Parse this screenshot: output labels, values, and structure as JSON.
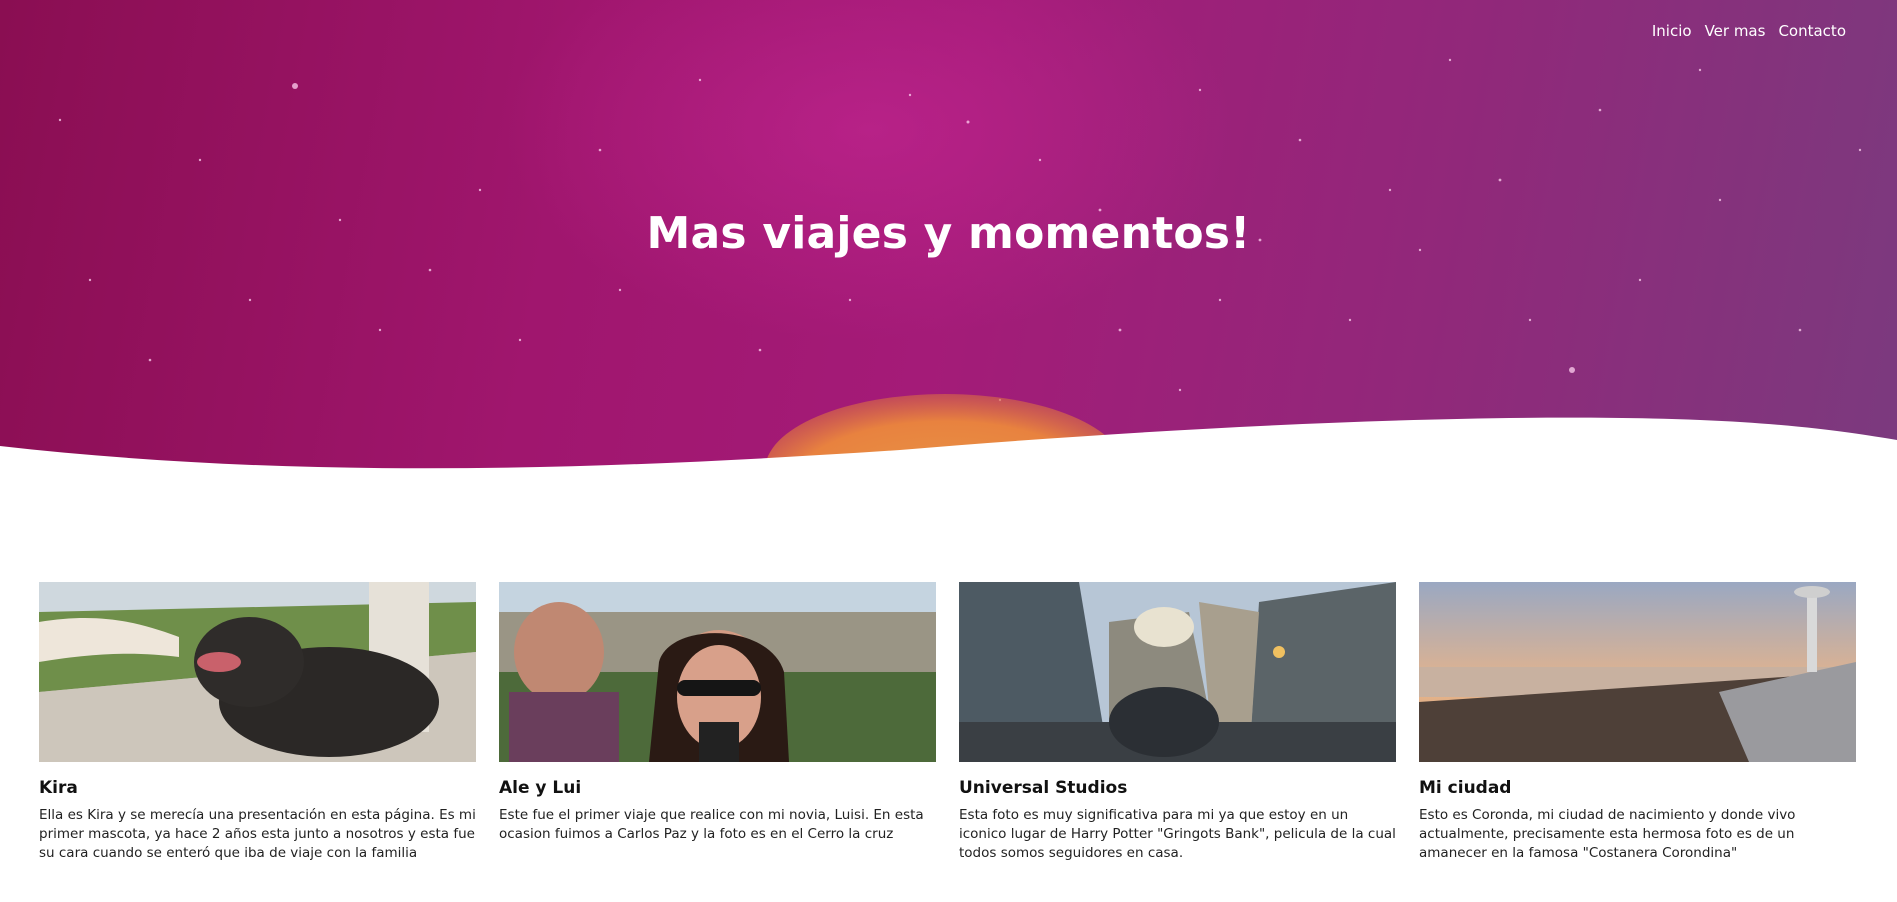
{
  "nav": {
    "items": [
      "Inicio",
      "Ver mas",
      "Contacto"
    ]
  },
  "hero": {
    "title": "Mas viajes y momentos!",
    "colors": {
      "gradient_start": "#8a0e52",
      "gradient_mid": "#a41b78",
      "gradient_end": "#7b3a7e",
      "sun": "#e8823f"
    }
  },
  "cards": [
    {
      "title": "Kira",
      "text": "Ella es Kira y se merecía una presentación en esta página. Es mi primer mascota, ya hace 2 años esta junto a nosotros y esta fue su cara cuando se enteró que iba de viaje con la familia",
      "image": "dog-photo"
    },
    {
      "title": "Ale y Lui",
      "text": "Este fue el primer viaje que realice con mi novia, Luisi. En esta ocasion fuimos a Carlos Paz y la foto es en el Cerro la cruz",
      "image": "couple-selfie-photo"
    },
    {
      "title": "Universal Studios",
      "text": "Esta foto es muy significativa para mi ya que estoy en un iconico lugar de Harry Potter \"Gringots Bank\", pelicula de la cual todos somos seguidores en casa.",
      "image": "theme-park-street-photo"
    },
    {
      "title": "Mi ciudad",
      "text": "Esto es Coronda, mi ciudad de nacimiento y donde vivo actualmente, precisamente esta hermosa foto es de un amanecer en la famosa \"Costanera Corondina\"",
      "image": "riverside-sunrise-photo"
    }
  ]
}
